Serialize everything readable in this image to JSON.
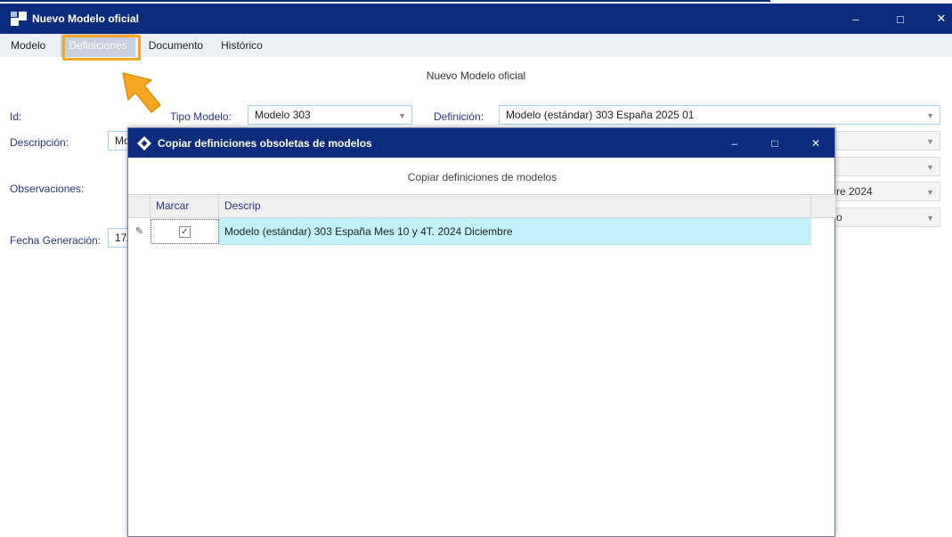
{
  "window": {
    "title": "Nuevo Modelo oficial",
    "minimize": "–",
    "maximize": "□",
    "close": "✕"
  },
  "menu": {
    "items": [
      {
        "label": "Modelo"
      },
      {
        "label": "Definiciones"
      },
      {
        "label": "Documento"
      },
      {
        "label": "Histórico"
      }
    ],
    "highlighted_index": 1
  },
  "form": {
    "title": "Nuevo Modelo oficial",
    "id_label": "Id:",
    "tipo_label": "Tipo Modelo:",
    "tipo_value": "Modelo 303",
    "definicion_label": "Definición:",
    "definicion_value": "Modelo (estándar) 303 España 2025 01",
    "descripcion_label": "Descripción:",
    "descripcion_value": "Mo",
    "observaciones_label": "Observaciones:",
    "fecha_label": "Fecha Generación:",
    "fecha_value": "17/",
    "right_field_3": "re 2024",
    "right_field_4": "o"
  },
  "dialog": {
    "title": "Copiar definiciones obsoletas de modelos",
    "subtitle": "Copiar definiciones de modelos",
    "minimize": "–",
    "maximize": "□",
    "close": "✕",
    "columns": [
      "Marcar",
      "Descrip"
    ],
    "rows": [
      {
        "checked": true,
        "check_glyph": "✓",
        "descrip": "Modelo (estándar) 303 España Mes 10  y 4T. 2024 Diciembre"
      }
    ],
    "edit_glyph": "✎"
  },
  "colors": {
    "title_bar": "#0b2b7f",
    "highlight_box": "#f5a623",
    "selected_row": "#c4f0fa",
    "label_blue": "#24348a"
  }
}
